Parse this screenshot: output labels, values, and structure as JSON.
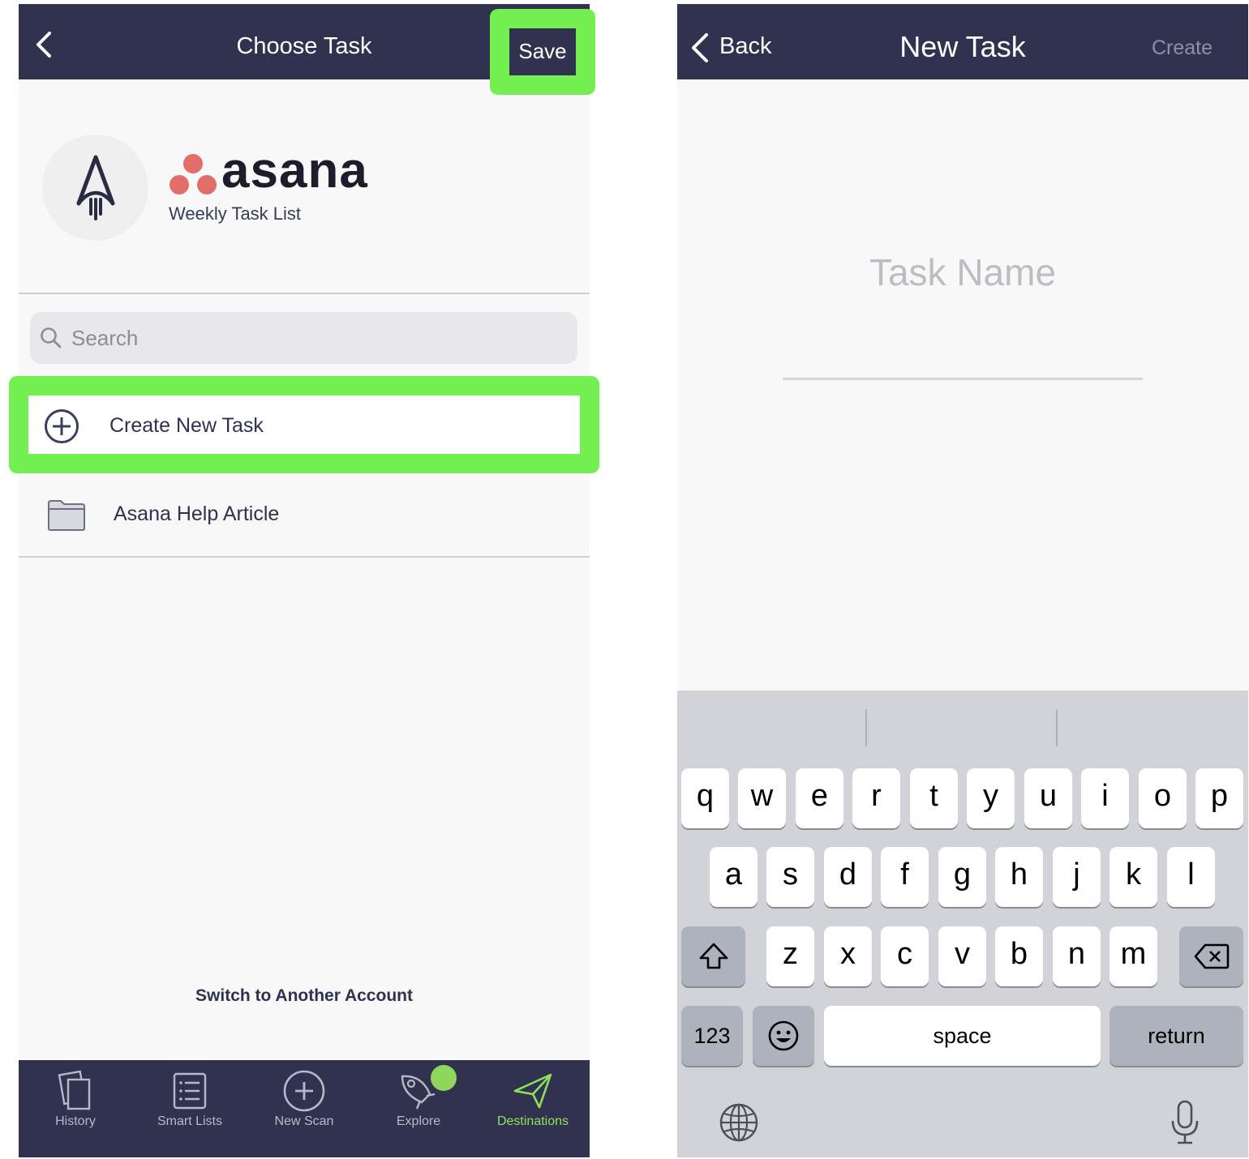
{
  "left_screen": {
    "nav": {
      "title": "Choose Task",
      "save_label": "Save"
    },
    "integration": {
      "name": "asana",
      "list_name": "Weekly Task List",
      "brand_dot_color": "#e16e6b"
    },
    "search": {
      "placeholder": "Search"
    },
    "items": [
      {
        "label": "Create New Task",
        "icon": "plus-circle-icon"
      },
      {
        "label": "Asana Help Article",
        "icon": "folder-icon"
      }
    ],
    "switch_account_label": "Switch to Another Account",
    "tabs": [
      {
        "label": "History",
        "icon": "history-icon",
        "active": false
      },
      {
        "label": "Smart Lists",
        "icon": "list-icon",
        "active": false
      },
      {
        "label": "New Scan",
        "icon": "plus-circle-icon",
        "active": false
      },
      {
        "label": "Explore",
        "icon": "rocket-icon",
        "active": false
      },
      {
        "label": "Destinations",
        "icon": "paper-plane-icon",
        "active": true
      }
    ],
    "highlight_color": "#73f04f",
    "nav_color": "#31324f"
  },
  "right_screen": {
    "nav": {
      "back_label": "Back",
      "title": "New Task",
      "create_label": "Create"
    },
    "task_name_placeholder": "Task Name",
    "keyboard": {
      "row1": [
        "q",
        "w",
        "e",
        "r",
        "t",
        "y",
        "u",
        "i",
        "o",
        "p"
      ],
      "row2": [
        "a",
        "s",
        "d",
        "f",
        "g",
        "h",
        "j",
        "k",
        "l"
      ],
      "row3": [
        "z",
        "x",
        "c",
        "v",
        "b",
        "n",
        "m"
      ],
      "numbers_label": "123",
      "space_label": "space",
      "return_label": "return"
    }
  }
}
